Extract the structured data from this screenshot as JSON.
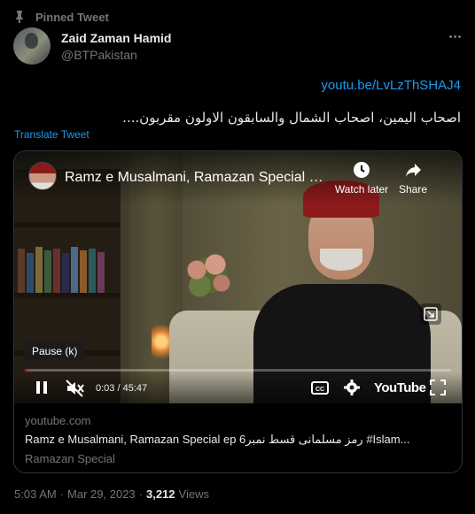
{
  "pinned": {
    "label": "Pinned Tweet"
  },
  "author": {
    "name": "Zaid Zaman Hamid",
    "handle": "@BTPakistan"
  },
  "tweet": {
    "link": "youtu.be/LvLzThSHAJ4",
    "text": "اصحاب الیمین، اصحاب الشمال والسابقون الاولون مقربون....",
    "translate": "Translate Tweet"
  },
  "video": {
    "title": "Ramz e Musalmani, Ramazan Special e...",
    "watch_later": "Watch later",
    "share": "Share",
    "pause_tooltip": "Pause (k)",
    "time": "0:03 / 45:47",
    "brand": "YouTube",
    "progress_fraction": 0.001
  },
  "card": {
    "domain": "youtube.com",
    "title": "Ramz e Musalmani, Ramazan Special ep 6رمز مسلمانی قسط نمبر #Islam...",
    "description": "Ramazan Special"
  },
  "footer": {
    "time": "5:03 AM",
    "sep": "·",
    "date": "Mar 29, 2023",
    "views_count": "3,212",
    "views_label": "Views"
  },
  "icons": [
    "pin-icon",
    "more-icon",
    "clock-icon",
    "share-icon",
    "expand-icon",
    "pause-icon",
    "mute-icon",
    "cc-icon",
    "settings-icon",
    "fullscreen-icon"
  ],
  "colors": {
    "accent": "#1d9bf0",
    "progress": "#ff0000",
    "background": "#000000"
  }
}
